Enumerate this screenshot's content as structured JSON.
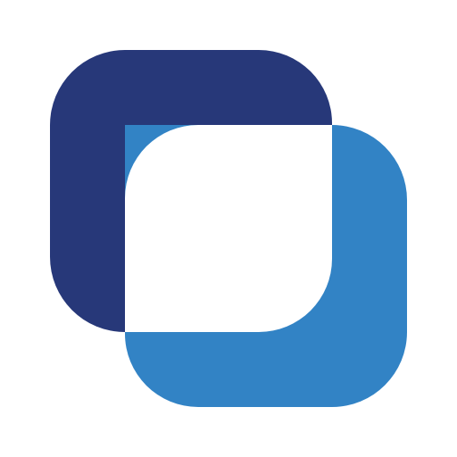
{
  "icon": {
    "name": "overlapping-rounded-squares-icon",
    "colors": {
      "background": "#ffffff",
      "back_square": "#273879",
      "front_square": "#3283c5",
      "inner_cutout": "#ffffff"
    }
  }
}
